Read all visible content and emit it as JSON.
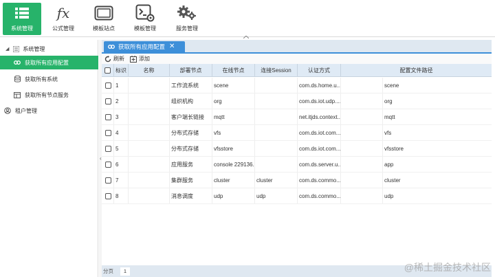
{
  "toolbar": {
    "items": [
      {
        "label": "系统管理",
        "icon": "list-icon",
        "active": true
      },
      {
        "label": "公式管理",
        "icon": "fx-icon",
        "active": false
      },
      {
        "label": "模板站点",
        "icon": "window-icon",
        "active": false
      },
      {
        "label": "模板管理",
        "icon": "terminal-gear-icon",
        "active": false
      },
      {
        "label": "服务管理",
        "icon": "gears-icon",
        "active": false
      }
    ]
  },
  "sidebar": {
    "root": {
      "label": "系统管理",
      "icon": "caret-down-icon"
    },
    "items": [
      {
        "label": "获取所有应用配置",
        "icon": "link-icon",
        "active": true
      },
      {
        "label": "获取所有系统",
        "icon": "database-icon",
        "active": false
      },
      {
        "label": "获取所有节点服务",
        "icon": "grid-icon",
        "active": false
      },
      {
        "label": "租户管理",
        "icon": "users-icon",
        "active": false
      }
    ]
  },
  "tab": {
    "label": "获取所有应用配置",
    "close": "✕"
  },
  "actions": {
    "refresh": "刷新",
    "add": "添加"
  },
  "table": {
    "headers": [
      "",
      "标识",
      "名称",
      "部署节点",
      "在线节点",
      "连接Session",
      "认证方式",
      "配置文件路径"
    ],
    "rows": [
      {
        "num": "1",
        "id": "",
        "name": "工作流系统",
        "deploy": "scene",
        "online": "",
        "session": "com.ds.home.u...",
        "auth": "",
        "path": "scene"
      },
      {
        "num": "2",
        "id": "",
        "name": "组织机构",
        "deploy": "org",
        "online": "",
        "session": "com.ds.iot.udp....",
        "auth": "",
        "path": "org"
      },
      {
        "num": "3",
        "id": "",
        "name": "客户端长链接",
        "deploy": "mqtt",
        "online": "",
        "session": "net.itjds.context...",
        "auth": "",
        "path": "mqtt"
      },
      {
        "num": "4",
        "id": "",
        "name": "分布式存储",
        "deploy": "vfs",
        "online": "",
        "session": "com.ds.iot.com...",
        "auth": "",
        "path": "vfs"
      },
      {
        "num": "5",
        "id": "",
        "name": "分布式存储",
        "deploy": "vfsstore",
        "online": "",
        "session": "com.ds.iot.com...",
        "auth": "",
        "path": "vfsstore"
      },
      {
        "num": "6",
        "id": "",
        "name": "应用服务",
        "deploy": "console 229136...",
        "online": "",
        "session": "com.ds.server.u...",
        "auth": "",
        "path": "app"
      },
      {
        "num": "7",
        "id": "",
        "name": "集群服务",
        "deploy": "cluster",
        "online": "cluster",
        "session": "com.ds.commo...",
        "auth": "",
        "path": "cluster"
      },
      {
        "num": "8",
        "id": "",
        "name": "消息调度",
        "deploy": "udp",
        "online": "udp",
        "session": "com.ds.commo...",
        "auth": "",
        "path": "udp"
      }
    ]
  },
  "pager": {
    "label": "分页",
    "page": "1"
  },
  "watermark": "@稀土掘金技术社区",
  "colors": {
    "accent_green": "#27b36a",
    "tab_blue": "#3d8fd9",
    "header_bg": "#dfeaf5"
  }
}
